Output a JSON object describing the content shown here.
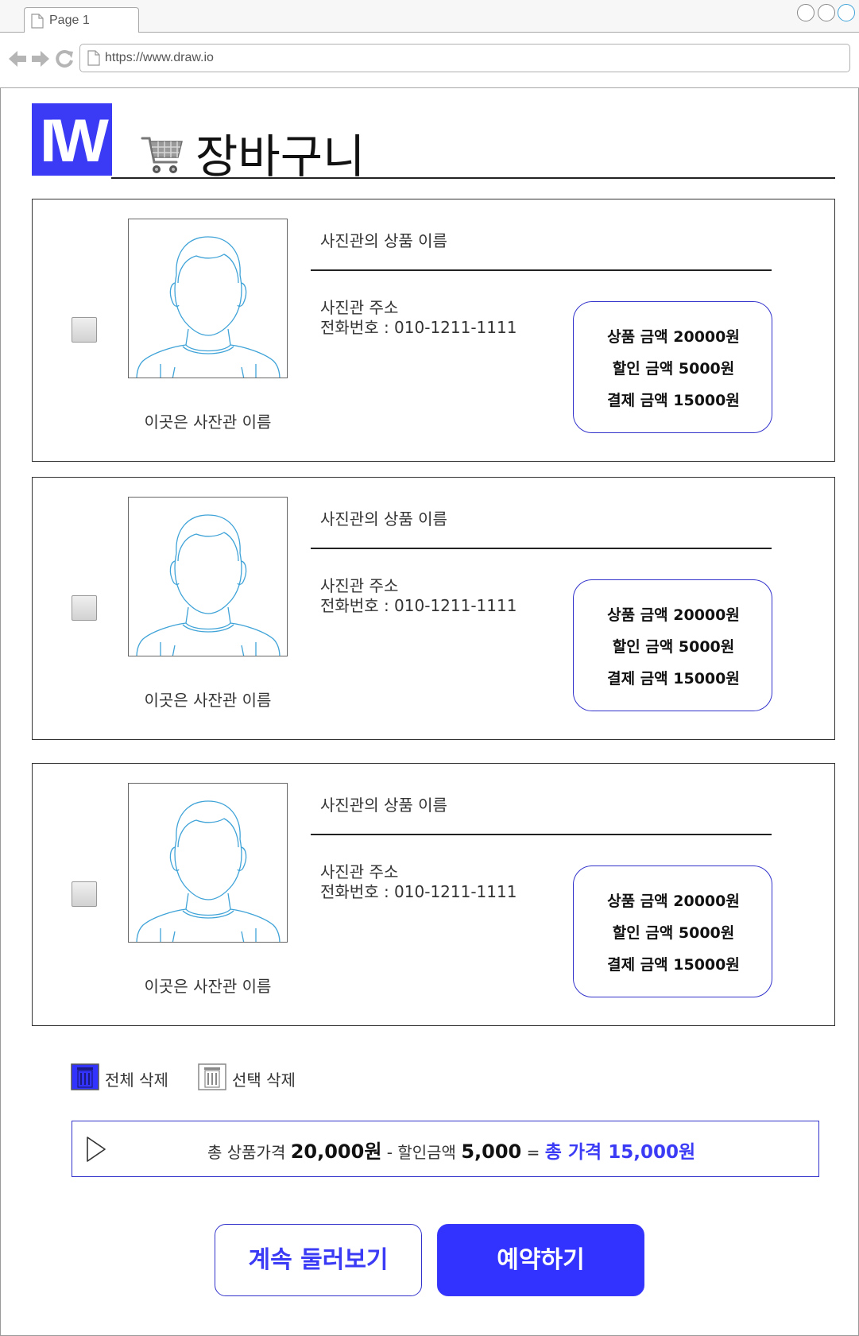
{
  "browser": {
    "tab_label": "Page 1",
    "url": "https://www.draw.io"
  },
  "header": {
    "logo_text": "IW",
    "title": "장바구니",
    "cart_icon": "shopping-cart-icon"
  },
  "cart": {
    "items": [
      {
        "studio_name": "이곳은 사잔관 이름",
        "product_name": "사진관의 상품 이름",
        "address": "사진관 주소",
        "phone": "전화번호 : 010-1211-1111",
        "price_label": "상품 금액 20000원",
        "discount_label": "할인 금액 5000원",
        "payment_label": "결제 금액 15000원",
        "checked": false
      },
      {
        "studio_name": "이곳은 사잔관 이름",
        "product_name": "사진관의 상품 이름",
        "address": "사진관 주소",
        "phone": "전화번호 : 010-1211-1111",
        "price_label": "상품 금액 20000원",
        "discount_label": "할인 금액 5000원",
        "payment_label": "결제 금액 15000원",
        "checked": false
      },
      {
        "studio_name": "이곳은 사잔관 이름",
        "product_name": "사진관의 상품 이름",
        "address": "사진관 주소",
        "phone": "전화번호 : 010-1211-1111",
        "price_label": "상품 금액 20000원",
        "discount_label": "할인 금액 5000원",
        "payment_label": "결제 금액 15000원",
        "checked": false
      }
    ]
  },
  "actions": {
    "delete_all_label": "전체 삭제",
    "delete_selected_label": "선택 삭제"
  },
  "summary": {
    "total_label": "총 상품가격",
    "total_value": "20,000원",
    "minus": "-",
    "discount_label": "할인금액",
    "discount_value": "5,000",
    "equals": "=",
    "final_text": "총 가격 15,000원"
  },
  "buttons": {
    "continue_label": "계속 둘러보기",
    "reserve_label": "예약하기"
  },
  "colors": {
    "accent": "#3333ff",
    "logo_bg": "#3b3bf6",
    "avatar_stroke": "#3fa3d8"
  }
}
